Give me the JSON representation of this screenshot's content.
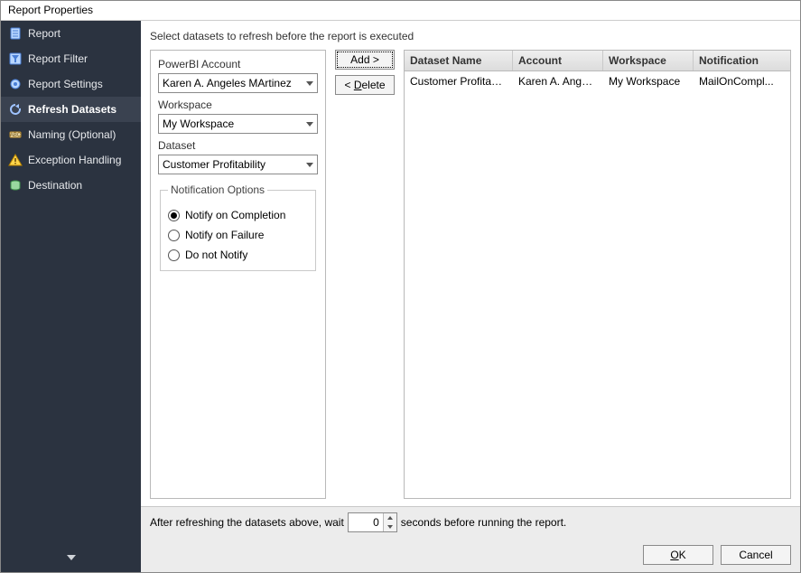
{
  "window": {
    "title": "Report Properties"
  },
  "sidebar": {
    "items": [
      {
        "label": "Report",
        "icon": "report-icon"
      },
      {
        "label": "Report Filter",
        "icon": "filter-icon"
      },
      {
        "label": "Report Settings",
        "icon": "settings-icon"
      },
      {
        "label": "Refresh Datasets",
        "icon": "refresh-icon",
        "selected": true
      },
      {
        "label": "Naming (Optional)",
        "icon": "naming-icon"
      },
      {
        "label": "Exception Handling",
        "icon": "warning-icon"
      },
      {
        "label": "Destination",
        "icon": "destination-icon"
      }
    ]
  },
  "main": {
    "instruction": "Select datasets to refresh before the report is executed",
    "form": {
      "account_label": "PowerBI Account",
      "account_value": "Karen A. Angeles MArtinez",
      "workspace_label": "Workspace",
      "workspace_value": "My Workspace",
      "dataset_label": "Dataset",
      "dataset_value": "Customer Profitability",
      "notif_legend": "Notification Options",
      "notif_options": [
        "Notify on Completion",
        "Notify on Failure",
        "Do not Notify"
      ],
      "notif_selected_index": 0
    },
    "actions": {
      "add": "Add >",
      "delete": "< Delete"
    },
    "grid": {
      "headers": [
        "Dataset Name",
        "Account",
        "Workspace",
        "Notification"
      ],
      "rows": [
        {
          "dataset": "Customer Profitabili...",
          "account": "Karen A. Angele...",
          "workspace": "My Workspace",
          "notification": "MailOnCompl..."
        }
      ]
    },
    "waitbar": {
      "prefix": "After refreshing the datasets above, wait",
      "value": "0",
      "suffix": "seconds before running the report."
    }
  },
  "footer": {
    "ok": "OK",
    "cancel": "Cancel"
  }
}
